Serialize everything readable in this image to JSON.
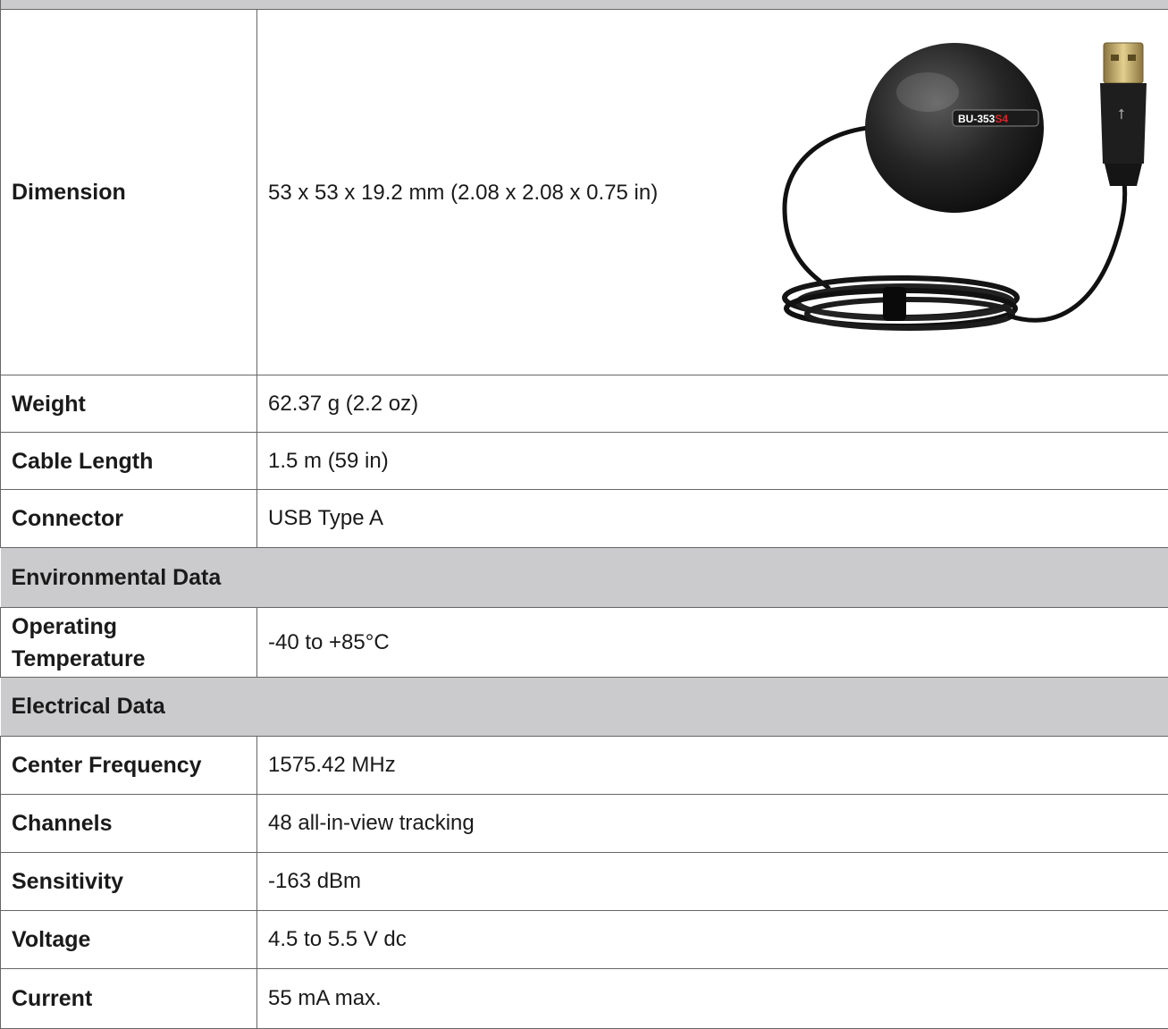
{
  "physical": {
    "rows": [
      {
        "label": "Dimension",
        "value": "53 x 53 x 19.2 mm (2.08 x 2.08 x 0.75 in)"
      },
      {
        "label": "Weight",
        "value": "62.37 g (2.2 oz)"
      },
      {
        "label": "Cable Length",
        "value": "1.5 m (59 in)"
      },
      {
        "label": "Connector",
        "value": "USB Type A"
      }
    ]
  },
  "product_image": {
    "model_label_black": "BU-353",
    "model_label_red": "S4"
  },
  "environmental": {
    "title": "Environmental Data",
    "rows": [
      {
        "label": "Operating Temperature",
        "value": "-40 to +85°C"
      }
    ]
  },
  "electrical": {
    "title": "Electrical Data",
    "rows": [
      {
        "label": "Center Frequency",
        "value": "1575.42 MHz"
      },
      {
        "label": "Channels",
        "value": "48 all-in-view tracking"
      },
      {
        "label": "Sensitivity",
        "value": "-163 dBm"
      },
      {
        "label": "Voltage",
        "value": "4.5 to 5.5 V dc"
      },
      {
        "label": "Current",
        "value": "55 mA max."
      }
    ]
  },
  "colors": {
    "section_bg": "#cbcbcd",
    "border": "#666666",
    "accent_red": "#d8262a"
  }
}
